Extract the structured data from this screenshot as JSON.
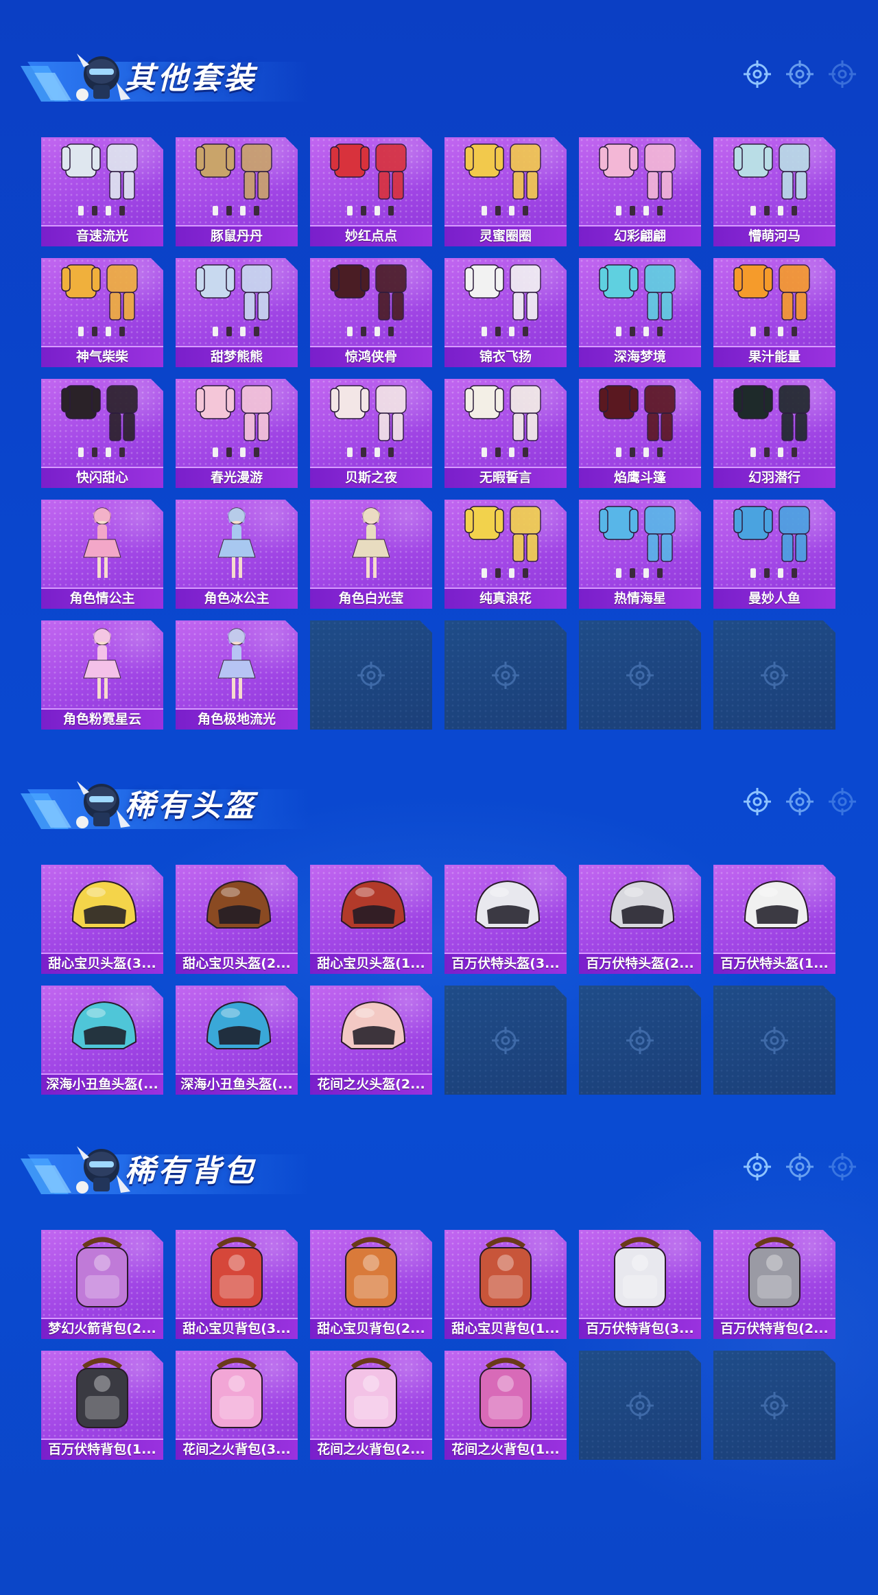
{
  "sections": [
    {
      "title": "其他套装",
      "items": [
        {
          "label": "音速流光",
          "art": "outfit",
          "color": "#dfe7ef"
        },
        {
          "label": "豚鼠丹丹",
          "art": "outfit",
          "color": "#c9a46a"
        },
        {
          "label": "妙红点点",
          "art": "outfit",
          "color": "#d8323c"
        },
        {
          "label": "灵蜜圈圈",
          "art": "outfit",
          "color": "#f2c94c"
        },
        {
          "label": "幻彩翩翩",
          "art": "outfit",
          "color": "#f3b7d6"
        },
        {
          "label": "懵萌河马",
          "art": "outfit",
          "color": "#b9dde6"
        },
        {
          "label": "神气柴柴",
          "art": "outfit",
          "color": "#f0b03c"
        },
        {
          "label": "甜梦熊熊",
          "art": "outfit",
          "color": "#c8d9ef"
        },
        {
          "label": "惊鸿侠骨",
          "art": "outfit",
          "color": "#4a1d24"
        },
        {
          "label": "锦衣飞扬",
          "art": "outfit",
          "color": "#f2f2f2"
        },
        {
          "label": "深海梦境",
          "art": "outfit",
          "color": "#5fd0e0"
        },
        {
          "label": "果汁能量",
          "art": "outfit",
          "color": "#f59b2b"
        },
        {
          "label": "快闪甜心",
          "art": "outfit",
          "color": "#2a2228"
        },
        {
          "label": "春光漫游",
          "art": "outfit",
          "color": "#f4c6d8"
        },
        {
          "label": "贝斯之夜",
          "art": "outfit",
          "color": "#f3e6e6"
        },
        {
          "label": "无暇誓言",
          "art": "outfit",
          "color": "#f3efe6"
        },
        {
          "label": "焰鹰斗篷",
          "art": "outfit",
          "color": "#5a1820"
        },
        {
          "label": "幻羽潜行",
          "art": "outfit",
          "color": "#1e2a2a"
        },
        {
          "label": "角色情公主",
          "art": "character",
          "color": "#f3a7c8"
        },
        {
          "label": "角色冰公主",
          "art": "character",
          "color": "#a8c8f0"
        },
        {
          "label": "角色白光莹",
          "art": "character",
          "color": "#e8dcc0"
        },
        {
          "label": "纯真浪花",
          "art": "outfit",
          "color": "#f2d24c"
        },
        {
          "label": "热情海星",
          "art": "outfit",
          "color": "#58b6e8"
        },
        {
          "label": "曼妙人鱼",
          "art": "outfit",
          "color": "#4aa3e0"
        },
        {
          "label": "角色粉霓星云",
          "art": "character",
          "color": "#f4c1e8"
        },
        {
          "label": "角色极地流光",
          "art": "character",
          "color": "#b7c4f4"
        },
        {
          "label": "",
          "art": "empty"
        },
        {
          "label": "",
          "art": "empty"
        },
        {
          "label": "",
          "art": "empty"
        },
        {
          "label": "",
          "art": "empty"
        }
      ]
    },
    {
      "title": "稀有头盔",
      "items": [
        {
          "label": "甜心宝贝头盔(3...",
          "art": "helmet",
          "color": "#f4d44a"
        },
        {
          "label": "甜心宝贝头盔(2...",
          "art": "helmet",
          "color": "#8a4a22"
        },
        {
          "label": "甜心宝贝头盔(1...",
          "art": "helmet",
          "color": "#b23a2a"
        },
        {
          "label": "百万伏特头盔(3...",
          "art": "helmet",
          "color": "#e8e8ee"
        },
        {
          "label": "百万伏特头盔(2...",
          "art": "helmet",
          "color": "#d8d8de"
        },
        {
          "label": "百万伏特头盔(1...",
          "art": "helmet",
          "color": "#f0f0f0"
        },
        {
          "label": "深海小丑鱼头盔(...",
          "art": "helmet",
          "color": "#4fc6d8"
        },
        {
          "label": "深海小丑鱼头盔(...",
          "art": "helmet",
          "color": "#3aa8d8"
        },
        {
          "label": "花间之火头盔(2...",
          "art": "helmet",
          "color": "#f3c9c4"
        },
        {
          "label": "",
          "art": "empty"
        },
        {
          "label": "",
          "art": "empty"
        },
        {
          "label": "",
          "art": "empty"
        }
      ]
    },
    {
      "title": "稀有背包",
      "items": [
        {
          "label": "梦幻火箭背包(2...",
          "art": "backpack",
          "color": "#c07ad8"
        },
        {
          "label": "甜心宝贝背包(3...",
          "art": "backpack",
          "color": "#d6473a"
        },
        {
          "label": "甜心宝贝背包(2...",
          "art": "backpack",
          "color": "#d97a3a"
        },
        {
          "label": "甜心宝贝背包(1...",
          "art": "backpack",
          "color": "#c8553a"
        },
        {
          "label": "百万伏特背包(3...",
          "art": "backpack",
          "color": "#e8e8ee"
        },
        {
          "label": "百万伏特背包(2...",
          "art": "backpack",
          "color": "#9a9aa4"
        },
        {
          "label": "百万伏特背包(1...",
          "art": "backpack",
          "color": "#3a3a42"
        },
        {
          "label": "花间之火背包(3...",
          "art": "backpack",
          "color": "#f2a6d6"
        },
        {
          "label": "花间之火背包(2...",
          "art": "backpack",
          "color": "#f3c2e6"
        },
        {
          "label": "花间之火背包(1...",
          "art": "backpack",
          "color": "#d86ab8"
        },
        {
          "label": "",
          "art": "empty"
        },
        {
          "label": "",
          "art": "empty"
        }
      ]
    }
  ]
}
